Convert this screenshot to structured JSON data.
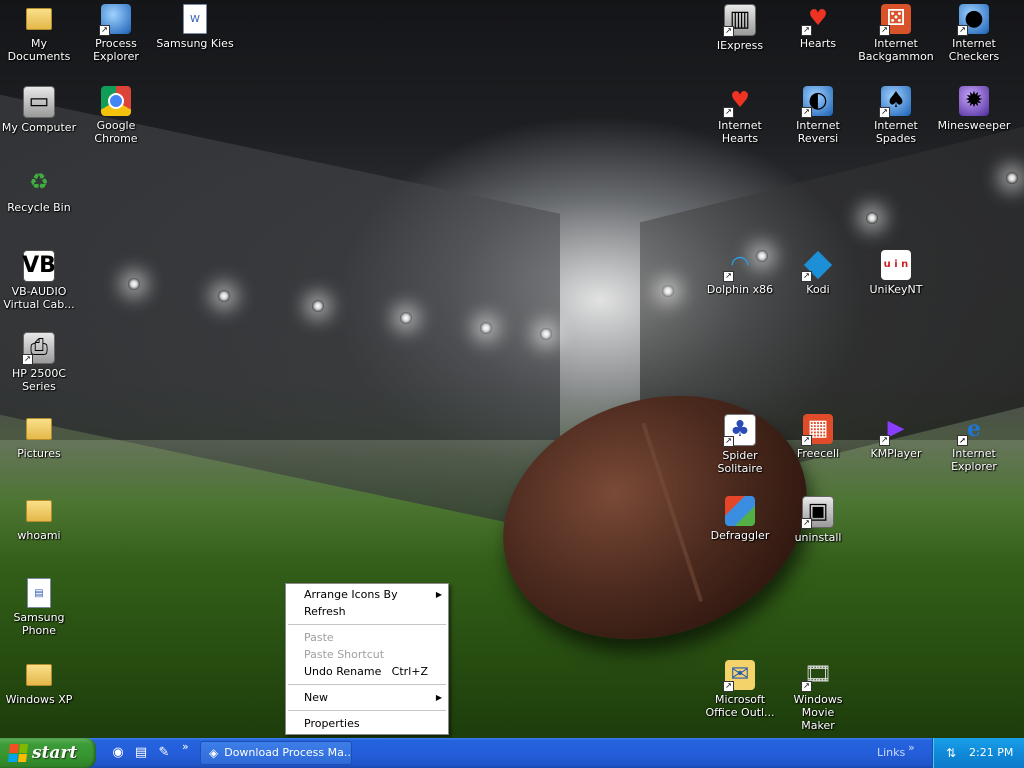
{
  "desktop": {
    "icons": [
      {
        "label": "My Documents",
        "icon": "my-documents-icon"
      },
      {
        "label": "Process\nExplorer",
        "icon": "process-explorer-icon"
      },
      {
        "label": "Samsung Kies",
        "icon": "samsung-kies-icon"
      },
      {
        "label": "My Computer",
        "icon": "my-computer-icon"
      },
      {
        "label": "Google Chrome",
        "icon": "chrome-icon"
      },
      {
        "label": "Recycle Bin",
        "icon": "recycle-bin-icon"
      },
      {
        "label": "VB-AUDIO\nVirtual Cab...",
        "icon": "vb-audio-icon"
      },
      {
        "label": "HP 2500C\nSeries",
        "icon": "printer-icon"
      },
      {
        "label": "Pictures",
        "icon": "folder-icon"
      },
      {
        "label": "whoami",
        "icon": "folder-icon"
      },
      {
        "label": "Samsung\nPhone",
        "icon": "samsung-phone-icon"
      },
      {
        "label": "Windows XP",
        "icon": "folder-icon"
      },
      {
        "label": "IExpress",
        "icon": "iexpress-icon"
      },
      {
        "label": "Hearts",
        "icon": "hearts-icon"
      },
      {
        "label": "Internet\nBackgammon",
        "icon": "backgammon-icon"
      },
      {
        "label": "Internet\nCheckers",
        "icon": "checkers-icon"
      },
      {
        "label": "Internet\nHearts",
        "icon": "internet-hearts-icon"
      },
      {
        "label": "Internet\nReversi",
        "icon": "reversi-icon"
      },
      {
        "label": "Internet\nSpades",
        "icon": "spades-icon"
      },
      {
        "label": "Minesweeper",
        "icon": "minesweeper-icon"
      },
      {
        "label": "Dolphin x86",
        "icon": "dolphin-icon"
      },
      {
        "label": "Kodi",
        "icon": "kodi-icon"
      },
      {
        "label": "UniKeyNT",
        "icon": "unikey-icon"
      },
      {
        "label": "Spider Solitaire",
        "icon": "spider-solitaire-icon"
      },
      {
        "label": "Freecell",
        "icon": "freecell-icon"
      },
      {
        "label": "KMPlayer",
        "icon": "kmplayer-icon"
      },
      {
        "label": "Internet\nExplorer",
        "icon": "internet-explorer-icon"
      },
      {
        "label": "Defraggler",
        "icon": "defraggler-icon"
      },
      {
        "label": "uninstall",
        "icon": "uninstall-icon"
      },
      {
        "label": "Microsoft\nOffice Outl...",
        "icon": "outlook-icon"
      },
      {
        "label": "Windows Movie\nMaker",
        "icon": "movie-maker-icon"
      }
    ]
  },
  "context_menu": {
    "items": [
      {
        "label": "Arrange Icons By",
        "submenu": true
      },
      {
        "label": "Refresh"
      },
      {
        "label": "Paste",
        "disabled": true
      },
      {
        "label": "Paste Shortcut",
        "disabled": true
      },
      {
        "label": "Undo Rename",
        "accelerator": "Ctrl+Z"
      },
      {
        "label": "New",
        "submenu": true
      },
      {
        "label": "Properties"
      }
    ]
  },
  "taskbar": {
    "start_label": "start",
    "quick_launch_chevron": "»",
    "task_button_label": "Download Process Ma...",
    "links_label": "Links",
    "links_chevron": "»",
    "clock": "2:21 PM"
  }
}
